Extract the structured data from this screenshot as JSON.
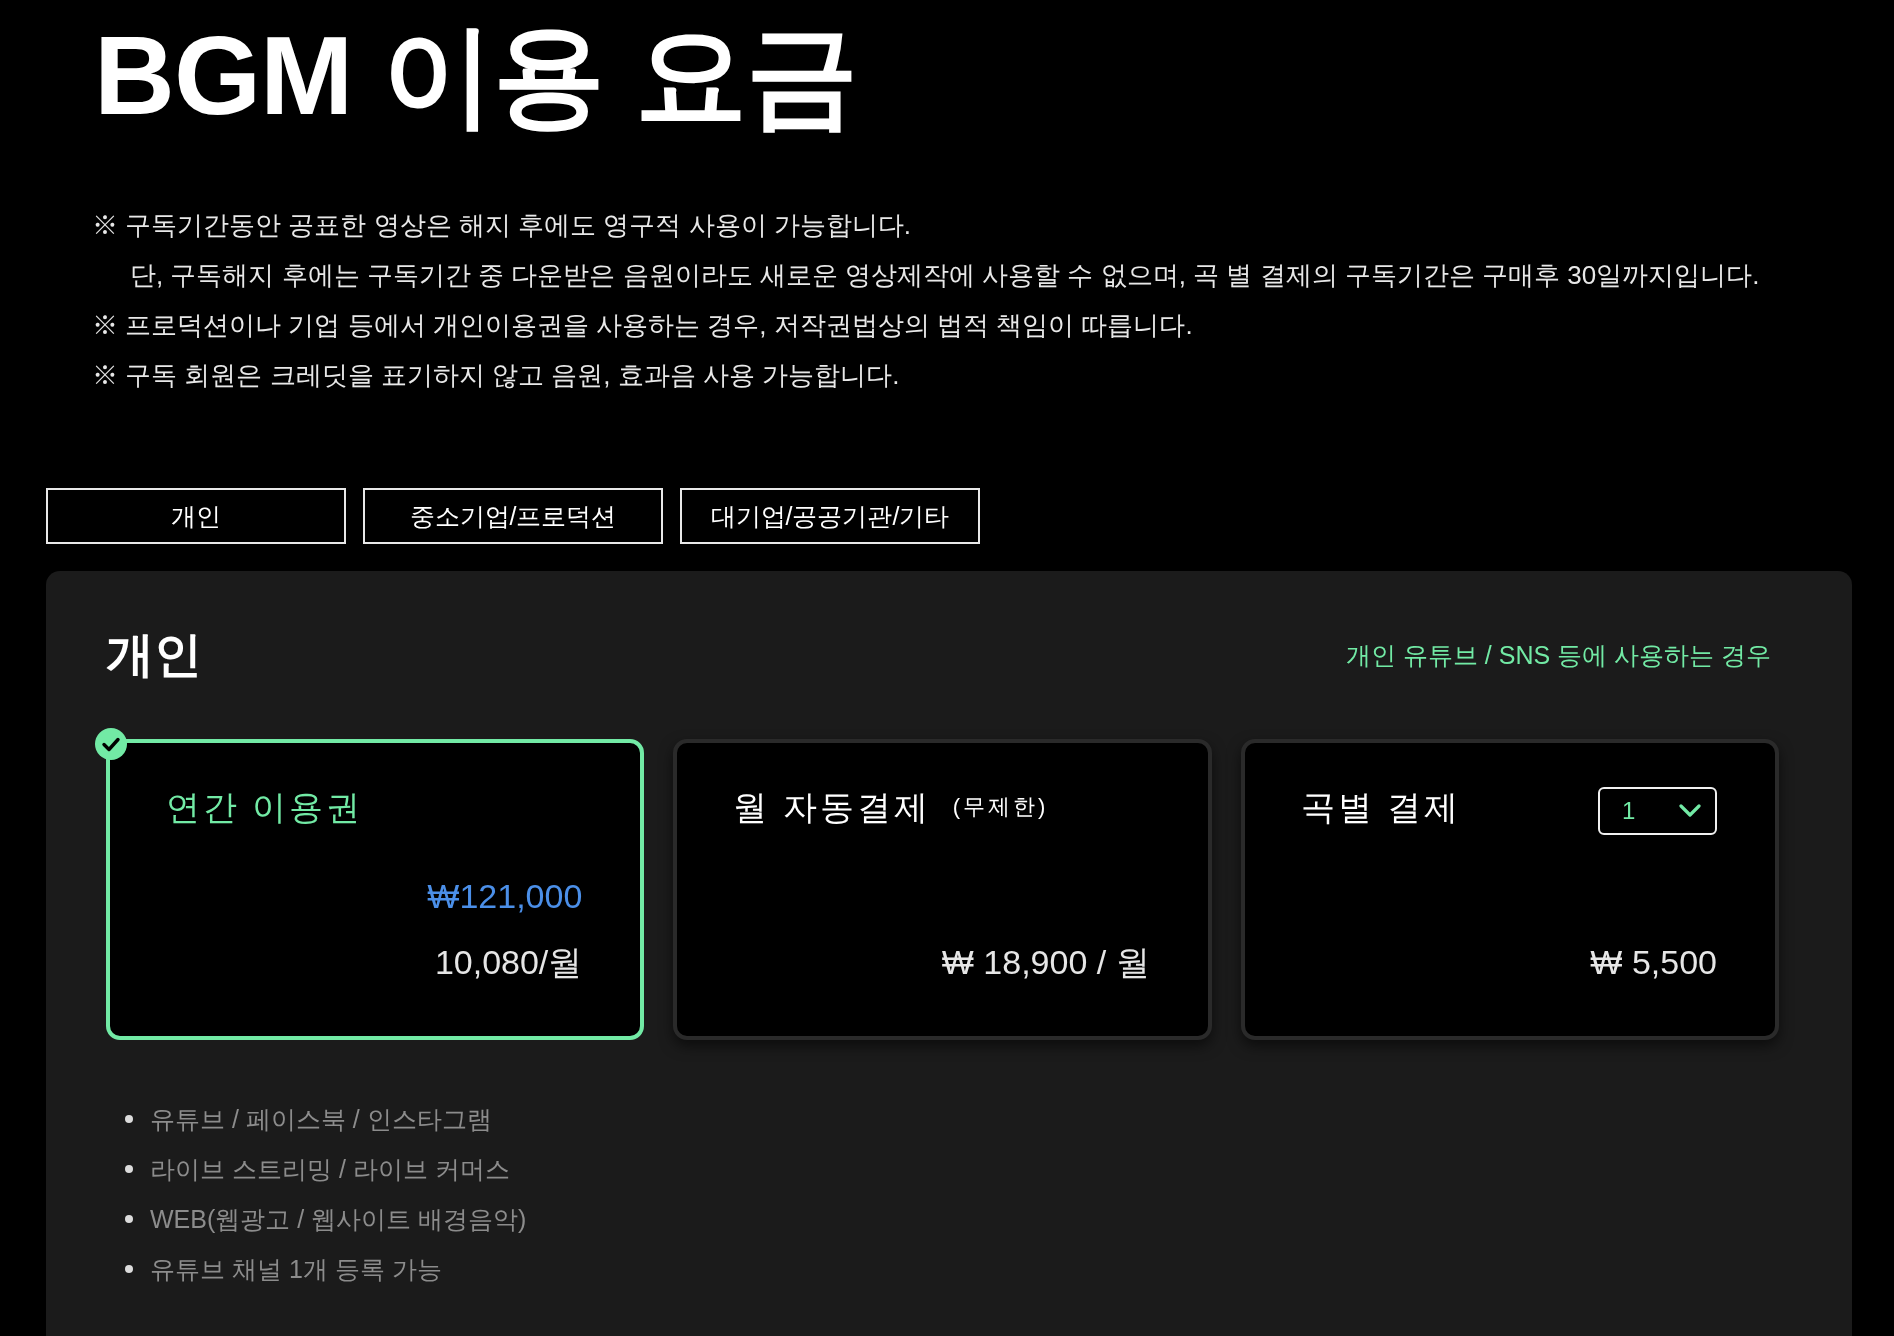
{
  "page_title": "BGM 이용 요금",
  "notes": [
    {
      "kind": "note",
      "text": "※ 구독기간동안 공표한 영상은 해지 후에도 영구적 사용이 가능합니다."
    },
    {
      "kind": "continuation",
      "text": "단, 구독해지 후에는 구독기간 중 다운받은 음원이라도 새로운 영상제작에 사용할 수 없으며, 곡 별 결제의 구독기간은 구매후 30일까지입니다."
    },
    {
      "kind": "note",
      "text": "※ 프로덕션이나 기업 등에서 개인이용권을 사용하는 경우, 저작권법상의 법적 책임이 따릅니다."
    },
    {
      "kind": "note",
      "text": "※ 구독 회원은 크레딧을 표기하지 않고 음원, 효과음 사용 가능합니다."
    }
  ],
  "plan_tabs": [
    {
      "label": "개인"
    },
    {
      "label": "중소기업/프로덕션"
    },
    {
      "label": "대기업/공공기관/기타"
    }
  ],
  "panel": {
    "title": "개인",
    "subtitle": "개인 유튜브 / SNS 등에 사용하는 경우",
    "plans": [
      {
        "title": "연간 이용권",
        "selected": true,
        "prices": [
          {
            "kind": "total",
            "text": "₩121,000"
          },
          {
            "kind": "amount",
            "text": "10,080/월"
          }
        ]
      },
      {
        "title": "월 자동결제",
        "note": "(무제한)",
        "selected": false,
        "prices": [
          {
            "kind": "amount",
            "text": "₩ 18,900 / 월"
          }
        ]
      },
      {
        "title": "곡별 결제",
        "quantity": "1",
        "selected": false,
        "prices": [
          {
            "kind": "amount",
            "text": "₩ 5,500"
          }
        ]
      }
    ],
    "features": [
      "유튜브 / 페이스북 / 인스타그램",
      "라이브 스트리밍 / 라이브 커머스",
      "WEB(웹광고 / 웹사이트 배경음악)",
      "유튜브 채널 1개 등록 가능"
    ]
  }
}
